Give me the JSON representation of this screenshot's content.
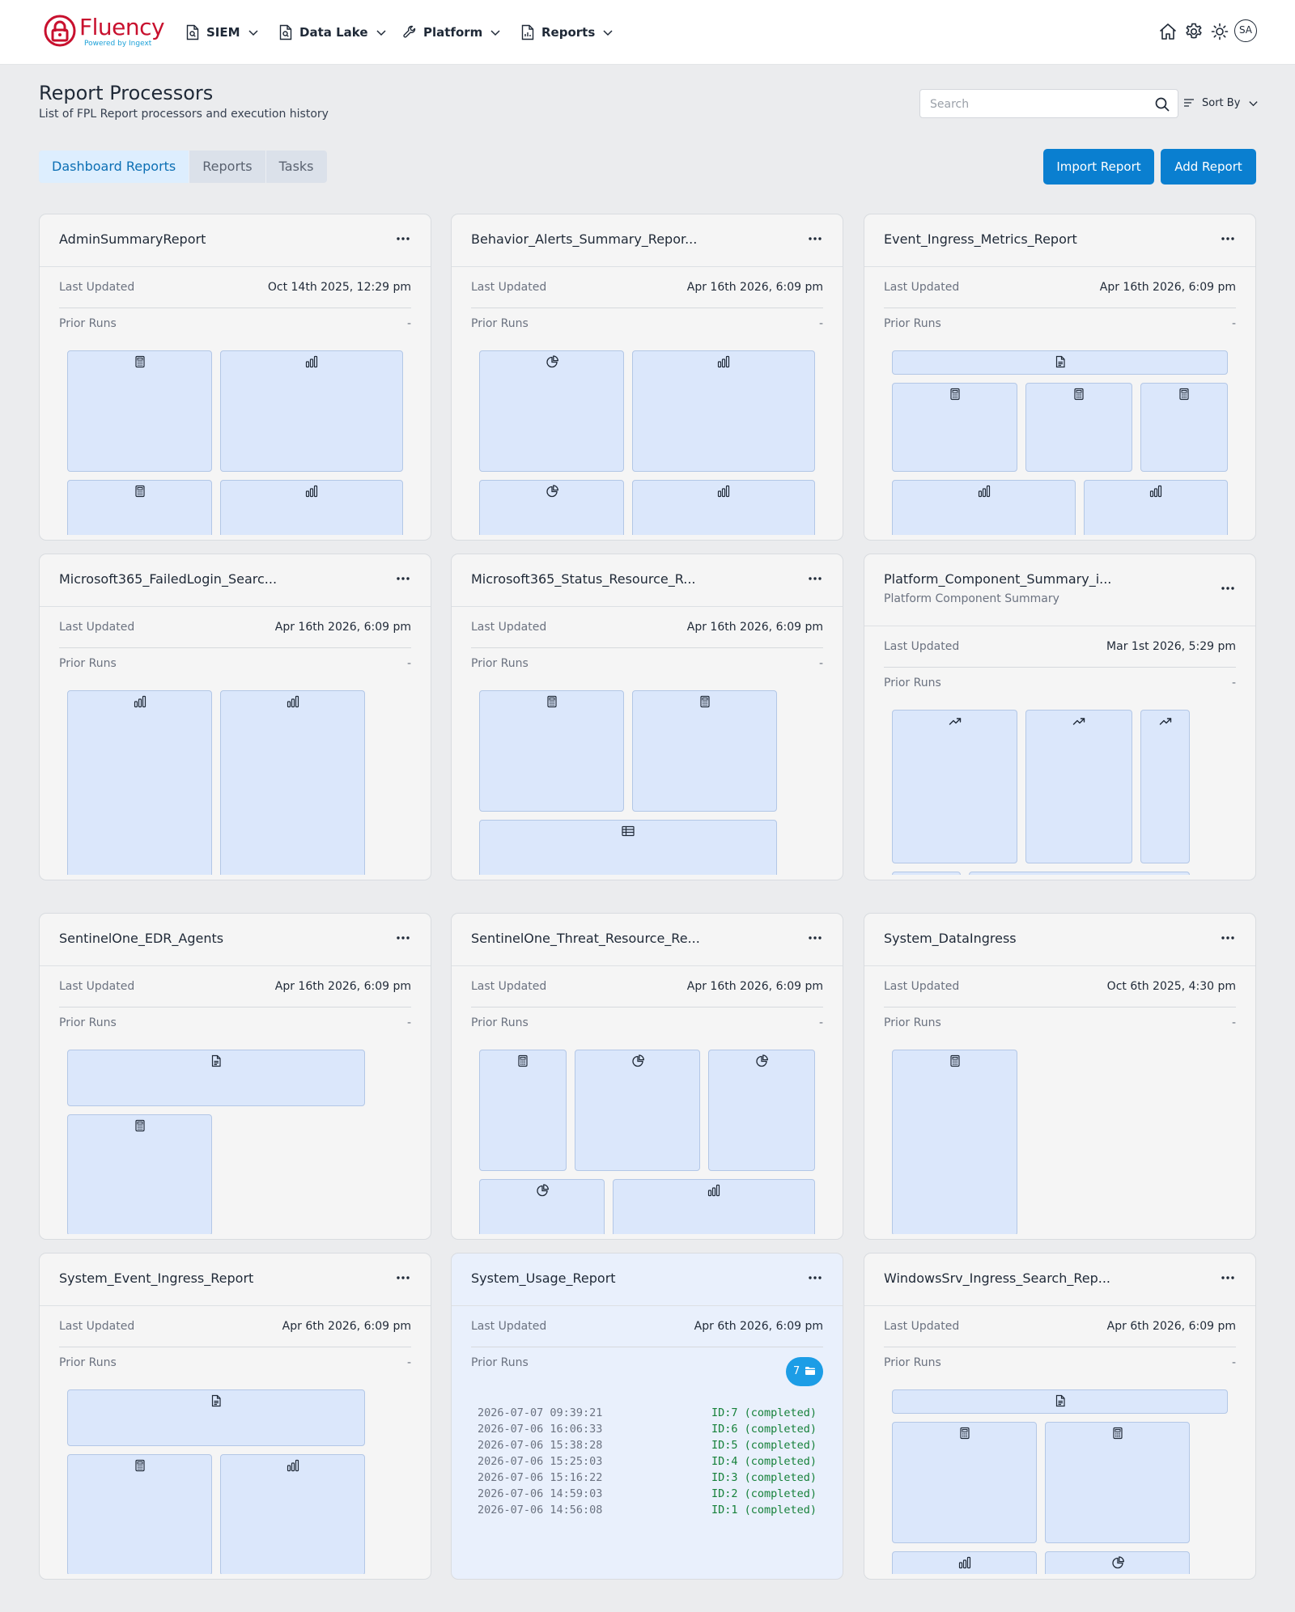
{
  "brand": {
    "name": "Fluency",
    "tagline": "Powered by Ingext"
  },
  "nav": [
    {
      "label": "SIEM",
      "icon": "file-search-icon"
    },
    {
      "label": "Data Lake",
      "icon": "file-search-icon"
    },
    {
      "label": "Platform",
      "icon": "wrench-icon"
    },
    {
      "label": "Reports",
      "icon": "report-icon"
    }
  ],
  "user": {
    "initials": "SA"
  },
  "page": {
    "title": "Report Processors",
    "subtitle": "List of FPL Report processors and execution history"
  },
  "search": {
    "placeholder": "Search",
    "value": ""
  },
  "sort": {
    "label": "Sort By"
  },
  "tabs": [
    {
      "label": "Dashboard Reports",
      "active": true
    },
    {
      "label": "Reports",
      "active": false
    },
    {
      "label": "Tasks",
      "active": false
    }
  ],
  "actions": {
    "import_label": "Import Report",
    "add_label": "Add Report"
  },
  "card_labels": {
    "last_updated": "Last Updated",
    "prior_runs": "Prior Runs",
    "none": "-"
  },
  "colors": {
    "accent": "#0a7fd0",
    "badge": "#1c9de6",
    "completed": "#16813a",
    "brand": "#c8102e",
    "tile": "#dbe7fb",
    "highlight_card": "#e9f0fc"
  },
  "cards": [
    {
      "title": "AdminSummaryReport",
      "subtitle": "",
      "last_updated": "Oct 14th 2025, 12:29 pm",
      "prior_runs": "-",
      "widgets": [
        "calculator-icon",
        "bar-chart-icon",
        "calculator-icon",
        "bar-chart-icon"
      ]
    },
    {
      "title": "Behavior_Alerts_Summary_Repor...",
      "subtitle": "",
      "last_updated": "Apr 16th 2026, 6:09 pm",
      "prior_runs": "-",
      "widgets": [
        "pie-chart-icon",
        "bar-chart-icon",
        "pie-chart-icon",
        "bar-chart-icon"
      ]
    },
    {
      "title": "Event_Ingress_Metrics_Report",
      "subtitle": "",
      "last_updated": "Apr 16th 2026, 6:09 pm",
      "prior_runs": "-",
      "widgets": [
        "document-icon",
        "calculator-icon",
        "calculator-icon",
        "calculator-icon",
        "bar-chart-icon",
        "bar-chart-icon"
      ]
    },
    {
      "title": "Microsoft365_FailedLogin_Searc...",
      "subtitle": "",
      "last_updated": "Apr 16th 2026, 6:09 pm",
      "prior_runs": "-",
      "widgets": [
        "bar-chart-icon",
        "bar-chart-icon"
      ]
    },
    {
      "title": "Microsoft365_Status_Resource_R...",
      "subtitle": "",
      "last_updated": "Apr 16th 2026, 6:09 pm",
      "prior_runs": "-",
      "widgets": [
        "calculator-icon",
        "calculator-icon",
        "table-icon"
      ]
    },
    {
      "title": "Platform_Component_Summary_i...",
      "subtitle": "Platform Component Summary",
      "last_updated": "Mar 1st 2026, 5:29 pm",
      "prior_runs": "-",
      "widgets": [
        "trend-icon",
        "trend-icon",
        "trend-icon",
        "bar-chart-icon",
        "trend-icon"
      ]
    },
    {
      "title": "SentinelOne_EDR_Agents",
      "subtitle": "",
      "last_updated": "Apr 16th 2026, 6:09 pm",
      "prior_runs": "-",
      "widgets": [
        "document-icon",
        "calculator-icon"
      ]
    },
    {
      "title": "SentinelOne_Threat_Resource_Re...",
      "subtitle": "",
      "last_updated": "Apr 16th 2026, 6:09 pm",
      "prior_runs": "-",
      "widgets": [
        "calculator-icon",
        "pie-chart-icon",
        "pie-chart-icon",
        "pie-chart-icon",
        "bar-chart-icon"
      ]
    },
    {
      "title": "System_DataIngress",
      "subtitle": "",
      "last_updated": "Oct 6th 2025, 4:30 pm",
      "prior_runs": "-",
      "widgets": [
        "calculator-icon"
      ]
    },
    {
      "title": "System_Event_Ingress_Report",
      "subtitle": "",
      "last_updated": "Apr 6th 2026, 6:09 pm",
      "prior_runs": "-",
      "widgets": [
        "document-icon",
        "calculator-icon",
        "bar-chart-icon"
      ]
    },
    {
      "title": "System_Usage_Report",
      "subtitle": "",
      "last_updated": "Apr 6th 2026, 6:09 pm",
      "prior_runs_count": "7",
      "runs": [
        {
          "time": "2026-07-07 09:39:21",
          "status": "ID:7 (completed)"
        },
        {
          "time": "2026-07-06 16:06:33",
          "status": "ID:6 (completed)"
        },
        {
          "time": "2026-07-06 15:38:28",
          "status": "ID:5 (completed)"
        },
        {
          "time": "2026-07-06 15:25:03",
          "status": "ID:4 (completed)"
        },
        {
          "time": "2026-07-06 15:16:22",
          "status": "ID:3 (completed)"
        },
        {
          "time": "2026-07-06 14:59:03",
          "status": "ID:2 (completed)"
        },
        {
          "time": "2026-07-06 14:56:08",
          "status": "ID:1 (completed)"
        }
      ]
    },
    {
      "title": "WindowsSrv_Ingress_Search_Rep...",
      "subtitle": "",
      "last_updated": "Apr 6th 2026, 6:09 pm",
      "prior_runs": "-",
      "widgets": [
        "document-icon",
        "calculator-icon",
        "calculator-icon",
        "bar-chart-icon",
        "pie-chart-icon"
      ]
    }
  ]
}
